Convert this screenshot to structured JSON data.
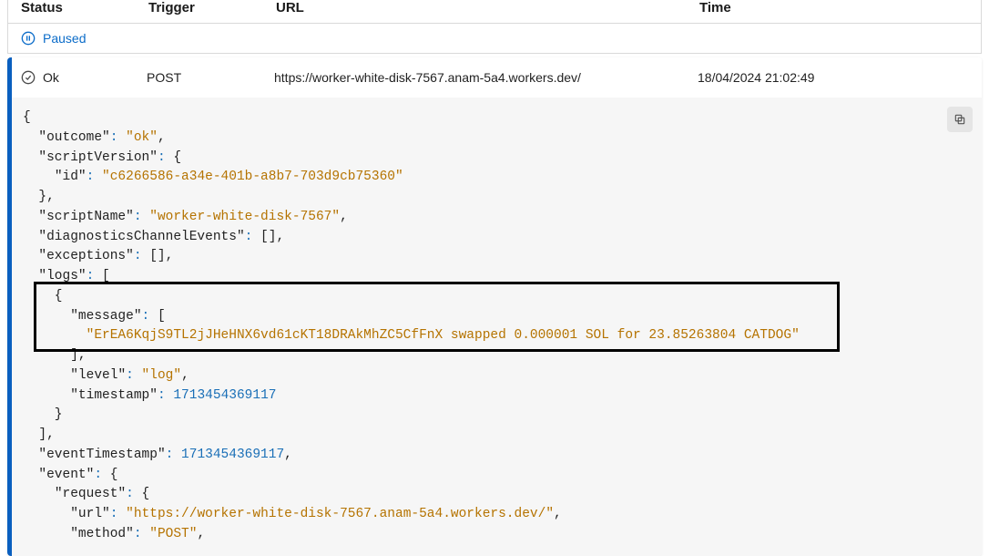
{
  "headers": {
    "status": "Status",
    "trigger": "Trigger",
    "url": "URL",
    "time": "Time"
  },
  "paused": {
    "label": "Paused"
  },
  "entry": {
    "status": "Ok",
    "trigger": "POST",
    "url": "https://worker-white-disk-7567.anam-5a4.workers.dev/",
    "time": "18/04/2024 21:02:49"
  },
  "json": {
    "outcome": "ok",
    "scriptVersion_id": "c6266586-a34e-401b-a8b7-703d9cb75360",
    "scriptName": "worker-white-disk-7567",
    "log_message": "ErEA6KqjS9TL2jJHeHNX6vd61cKT18DRAkMhZC5CfFnX swapped 0.000001 SOL for 23.85263804 CATDOG",
    "log_level": "log",
    "log_timestamp": "1713454369117",
    "eventTimestamp": "1713454369117",
    "event_request_url": "https://worker-white-disk-7567.anam-5a4.workers.dev/",
    "event_request_method": "POST"
  },
  "labels": {
    "outcome": "outcome",
    "scriptVersion": "scriptVersion",
    "id": "id",
    "scriptName": "scriptName",
    "diagnosticsChannelEvents": "diagnosticsChannelEvents",
    "exceptions": "exceptions",
    "logs": "logs",
    "message": "message",
    "level": "level",
    "timestamp": "timestamp",
    "eventTimestamp": "eventTimestamp",
    "event": "event",
    "request": "request",
    "url": "url",
    "method": "method"
  }
}
